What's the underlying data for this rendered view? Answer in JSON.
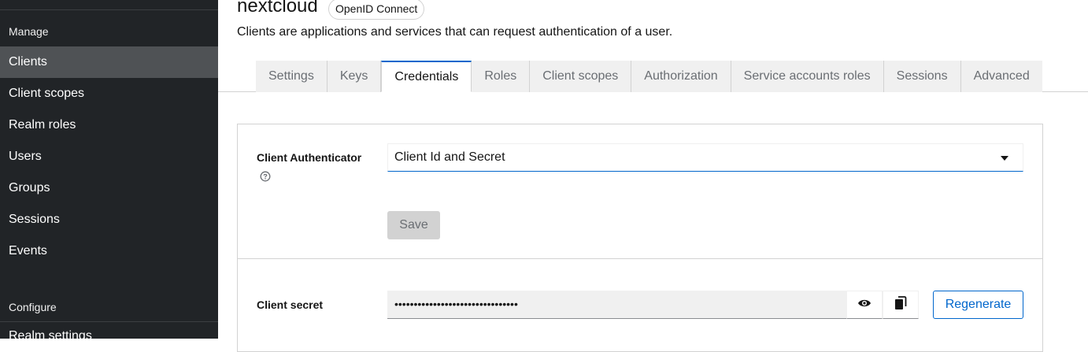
{
  "sidebar": {
    "sections": [
      {
        "title": "Manage",
        "items": [
          "Clients",
          "Client scopes",
          "Realm roles",
          "Users",
          "Groups",
          "Sessions",
          "Events"
        ]
      },
      {
        "title": "Configure",
        "items": [
          "Realm settings"
        ]
      }
    ],
    "active_item": "Clients"
  },
  "header": {
    "title": "nextcloud",
    "badge": "OpenID Connect",
    "subtitle": "Clients are applications and services that can request authentication of a user."
  },
  "tabs": [
    {
      "label": "Settings",
      "active": false
    },
    {
      "label": "Keys",
      "active": false
    },
    {
      "label": "Credentials",
      "active": true
    },
    {
      "label": "Roles",
      "active": false
    },
    {
      "label": "Client scopes",
      "active": false
    },
    {
      "label": "Authorization",
      "active": false
    },
    {
      "label": "Service accounts roles",
      "active": false
    },
    {
      "label": "Sessions",
      "active": false
    },
    {
      "label": "Advanced",
      "active": false
    }
  ],
  "credentials": {
    "authenticator_label": "Client Authenticator",
    "authenticator_value": "Client Id and Secret",
    "save_label": "Save",
    "secret_label": "Client secret",
    "secret_value": "••••••••••••••••••••••••••••••••",
    "regenerate_label": "Regenerate"
  },
  "icons": {
    "help": "help-circle-icon",
    "caret": "caret-down-icon",
    "show": "eye-icon",
    "copy": "copy-icon"
  },
  "colors": {
    "sidebar_bg": "#212427",
    "sidebar_active": "#4f5255",
    "accent": "#0066cc",
    "tab_bg": "#f0f0f0"
  }
}
